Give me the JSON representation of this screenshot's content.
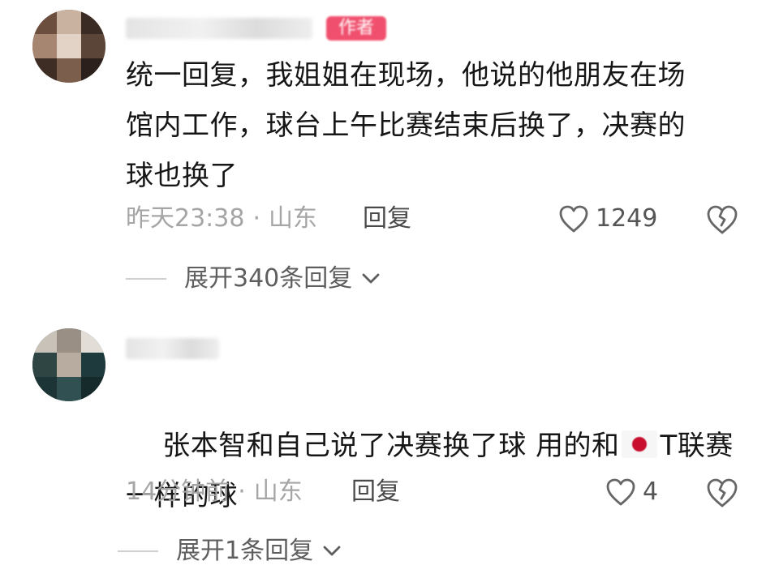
{
  "comments": [
    {
      "body": "统一回复，我姐姐在现场，他说的他朋友在场\n馆内工作，球台上午比赛结束后换了，决赛的\n球也换了",
      "time": "昨天23:38",
      "location": "山东",
      "reply_label": "回复",
      "likes": "1249",
      "author_tag": "作者",
      "expand_label": "展开340条回复"
    },
    {
      "body_pre_flag": "张本智和自己说了决赛换了球 用的和",
      "body_post_flag": "T联赛\n一样的球",
      "time": "14分钟前",
      "location": "山东",
      "reply_label": "回复",
      "likes": "4",
      "expand_label": "展开1条回复"
    }
  ],
  "icons": {
    "like": "heart-outline-icon",
    "dislike": "broken-heart-icon",
    "expand": "chevron-down-icon",
    "flag": "japan-flag-icon"
  },
  "colors": {
    "author_tag": "#f0506e",
    "meta": "#a5a5a5"
  }
}
